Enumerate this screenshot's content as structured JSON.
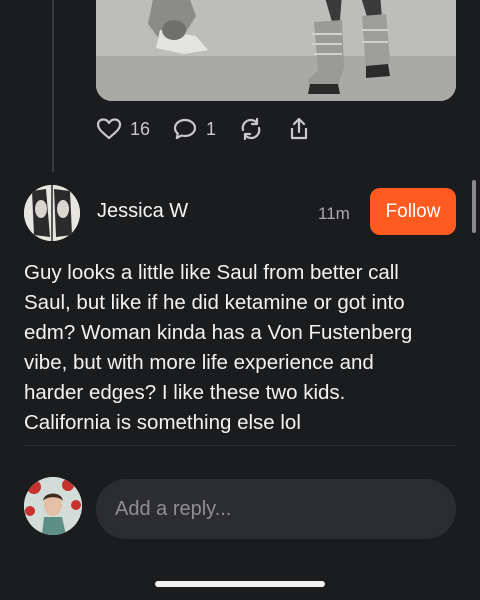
{
  "post": {
    "likes": "16",
    "replies": "1"
  },
  "comment": {
    "author": "Jessica W",
    "time": "11m",
    "follow_label": "Follow",
    "lines": [
      "Guy looks a little like Saul from better call",
      "Saul, but like if he did ketamine or got into",
      "edm? Woman kinda has a Von Fustenberg",
      "vibe, but with more life experience and",
      "harder edges? I like these two kids.",
      "California is something else lol"
    ]
  },
  "reply": {
    "placeholder": "Add a reply..."
  },
  "colors": {
    "background": "#1b1c1e",
    "accent": "#ff5a1f"
  },
  "icons": [
    "heart-icon",
    "comment-icon",
    "repost-icon",
    "share-icon"
  ]
}
